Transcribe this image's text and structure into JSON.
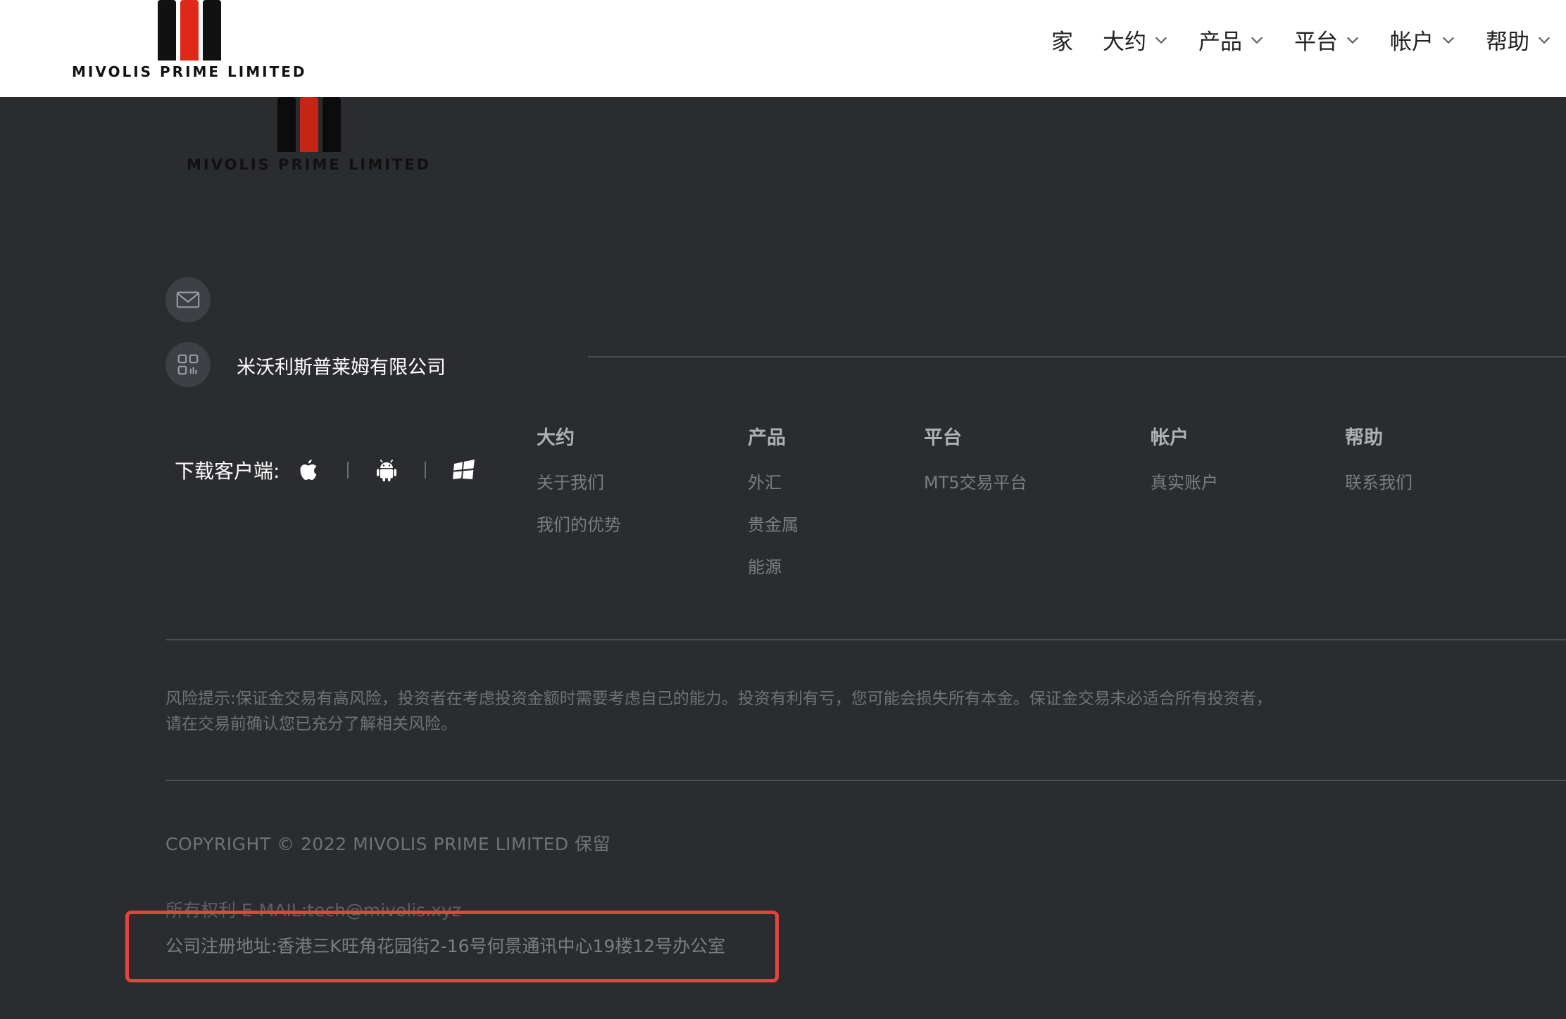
{
  "brand": {
    "name": "MIVOLIS PRIME LIMITED",
    "accent": "#e02818"
  },
  "nav": {
    "items": [
      {
        "label": "家",
        "has_dropdown": false
      },
      {
        "label": "大约",
        "has_dropdown": true
      },
      {
        "label": "产品",
        "has_dropdown": true
      },
      {
        "label": "平台",
        "has_dropdown": true
      },
      {
        "label": "帐户",
        "has_dropdown": true
      },
      {
        "label": "帮助",
        "has_dropdown": true
      }
    ]
  },
  "footer": {
    "company_name": "米沃利斯普莱姆有限公司",
    "download_label": "下载客户端:",
    "download_icons": [
      "apple-icon",
      "android-icon",
      "windows-icon"
    ],
    "columns": [
      {
        "title": "大约",
        "links": [
          "关于我们",
          "我们的优势"
        ]
      },
      {
        "title": "产品",
        "links": [
          "外汇",
          "贵金属",
          "能源"
        ]
      },
      {
        "title": "平台",
        "links": [
          "MT5交易平台"
        ]
      },
      {
        "title": "帐户",
        "links": [
          "真实账户"
        ]
      },
      {
        "title": "帮助",
        "links": [
          "联系我们"
        ]
      }
    ],
    "risk_line1": "风险提示:保证金交易有高风险，投资者在考虑投资金额时需要考虑自己的能力。投资有利有亏，您可能会损失所有本金。保证金交易未必适合所有投资者，",
    "risk_line2": "请在交易前确认您已充分了解相关风险。",
    "copyright": "COPYRIGHT © 2022 MIVOLIS PRIME LIMITED 保留",
    "rights_email": "所有权利 E-MAIL:tech@mivolis.xyz",
    "address": "公司注册地址:香港三K旺角花园街2-16号何景通讯中心19楼12号办公室",
    "highlight_color": "#e8423e"
  }
}
